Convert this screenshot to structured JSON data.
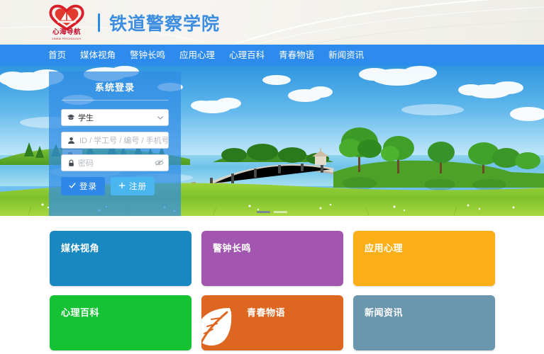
{
  "header": {
    "logo_name": "xinhai-daohang-logo",
    "logo_text": "心海导航",
    "logo_subtext": "XINHAI PSYCHOLOGY",
    "site_title": "铁道警察学院",
    "title_color": "#3d8ee0",
    "logo_color": "#c8102e"
  },
  "nav": {
    "bg_color": "#2e8bee",
    "items": [
      {
        "label": "首页",
        "active": true
      },
      {
        "label": "媒体视角",
        "active": false
      },
      {
        "label": "警钟长鸣",
        "active": false
      },
      {
        "label": "应用心理",
        "active": false
      },
      {
        "label": "心理百科",
        "active": false
      },
      {
        "label": "青春物语",
        "active": false
      },
      {
        "label": "新闻资讯",
        "active": false
      }
    ]
  },
  "banner": {
    "alt": "lakeside landscape with wooden bridge, green meadow, trees, house and blue cloudy sky",
    "dots": [
      {
        "active": true
      },
      {
        "active": false
      }
    ]
  },
  "login": {
    "title": "系统登录",
    "role_select": {
      "value": "学生",
      "icon": "graduation-cap-icon",
      "chevron": "chevron-down-icon"
    },
    "account": {
      "placeholder": "ID / 学工号 / 编号 / 手机号",
      "value": "",
      "icon": "user-icon"
    },
    "password": {
      "placeholder": "密码",
      "value": "",
      "icon": "lock-icon",
      "toggle_icon": "eye-slash-icon"
    },
    "login_button": {
      "label": "登录",
      "icon": "check-icon",
      "color": "#2f87e8"
    },
    "register_button": {
      "label": "注册",
      "icon": "plus-icon",
      "color": "#4ab6ef"
    }
  },
  "cards": [
    {
      "label": "媒体视角",
      "color": "#1a88c0",
      "icon": ""
    },
    {
      "label": "警钟长鸣",
      "color": "#a356b0",
      "icon": ""
    },
    {
      "label": "应用心理",
      "color": "#fbaf17",
      "icon": ""
    },
    {
      "label": "心理百科",
      "color": "#14c233",
      "icon": ""
    },
    {
      "label": "青春物语",
      "color": "#dd6620",
      "icon": "leaf-icon"
    },
    {
      "label": "新闻资讯",
      "color": "#6a96ae",
      "icon": ""
    }
  ]
}
